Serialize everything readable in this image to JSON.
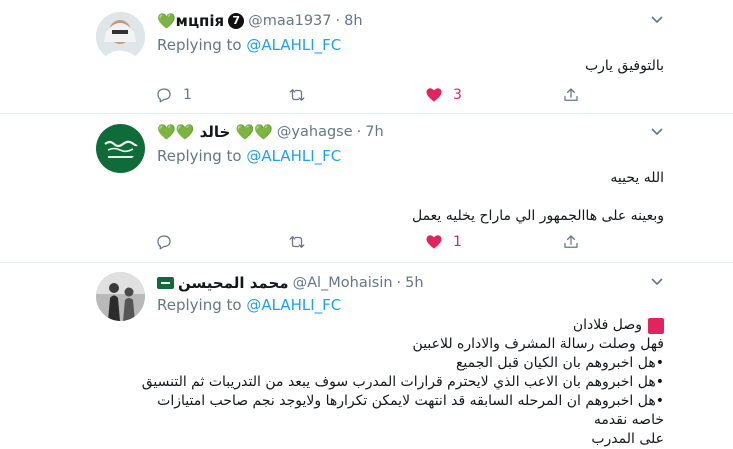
{
  "tweets": [
    {
      "name": "💚мцпія",
      "verified_glyph": "7",
      "handle": "@maa1937",
      "sep": "·",
      "time": "8h",
      "replying_prefix": "Replying to ",
      "replying_to": "@ALAHLI_FC",
      "lines": [
        "بالتوفيق يارب"
      ],
      "reply_count": "1",
      "retweet_count": "",
      "like_count": "3",
      "liked": true
    },
    {
      "name": "💚💚 خالد 💚💚",
      "handle": "@yahagse",
      "sep": "·",
      "time": "7h",
      "replying_prefix": "Replying to ",
      "replying_to": "@ALAHLI_FC",
      "lines": [
        "الله يحييه",
        "",
        "وبعينه على هاالجمهور الي ماراح يخليه يعمل"
      ],
      "reply_count": "",
      "retweet_count": "",
      "like_count": "1",
      "liked": true
    },
    {
      "name": "محمد المحيسن",
      "handle": "@Al_Mohaisin",
      "sep": "·",
      "time": "5h",
      "replying_prefix": "Replying to ",
      "replying_to": "@ALAHLI_FC",
      "lines": [
        "وصل فلادان",
        "فهل وصلت رسالة المشرف والاداره للاعبين",
        "•هل اخبروهم بان الكيان قبل الجميع",
        "•هل اخبروهم بان الاعب الذي لايحترم قرارات المدرب سوف يبعد من التدريبات ثم التنسيق",
        "•هل اخبروهم ان المرحله السابقه قد انتهت لايمكن تكرارها ولايوجد نجم صاحب امتيازات خاصه نقدمه",
        "على المدرب"
      ]
    }
  ],
  "colors": {
    "link": "#1da1f2",
    "muted": "#657786",
    "like": "#e0245e"
  }
}
